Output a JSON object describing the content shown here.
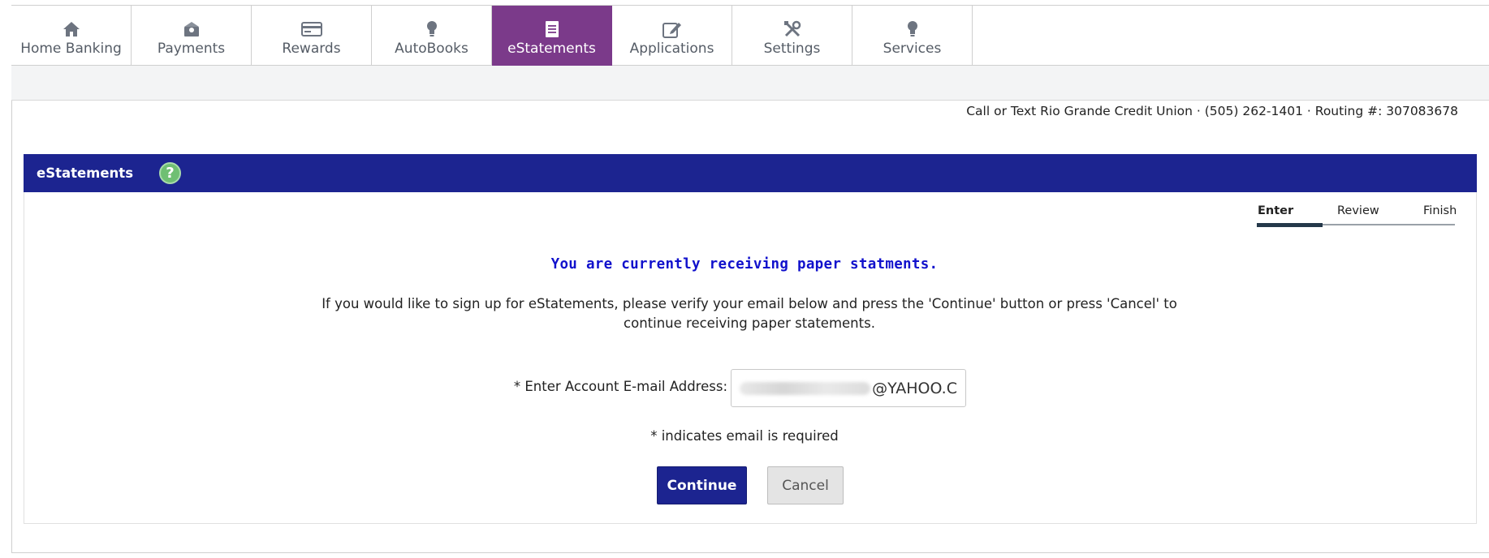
{
  "nav": {
    "tabs": [
      {
        "label": "Home Banking",
        "icon": "home-icon"
      },
      {
        "label": "Payments",
        "icon": "payments-icon"
      },
      {
        "label": "Rewards",
        "icon": "card-icon"
      },
      {
        "label": "AutoBooks",
        "icon": "lightbulb-icon"
      },
      {
        "label": "eStatements",
        "icon": "document-icon",
        "active": true
      },
      {
        "label": "Applications",
        "icon": "edit-icon"
      },
      {
        "label": "Settings",
        "icon": "tools-icon"
      },
      {
        "label": "Services",
        "icon": "lightbulb-icon"
      }
    ]
  },
  "contact_line": "Call or Text Rio Grande Credit Union · (505) 262-1401 · Routing #: 307083678",
  "panel": {
    "title": "eStatements",
    "help_glyph": "?"
  },
  "steps": {
    "enter": "Enter",
    "review": "Review",
    "finish": "Finish",
    "current": 1
  },
  "main": {
    "headline": "You are currently receiving paper statments.",
    "description": "If you would like to sign up for eStatements, please verify your email below and press the 'Continue' button or press 'Cancel' to continue receiving paper statements.",
    "email_label": "* Enter Account E-mail Address:",
    "email_visible_value": "@YAHOO.C",
    "required_note": "* indicates email is required",
    "continue_label": "Continue",
    "cancel_label": "Cancel"
  },
  "colors": {
    "accent_purple": "#7b3a8a",
    "header_blue": "#1c2490",
    "headline_blue": "#1111cc",
    "help_green": "#6fbf73"
  }
}
